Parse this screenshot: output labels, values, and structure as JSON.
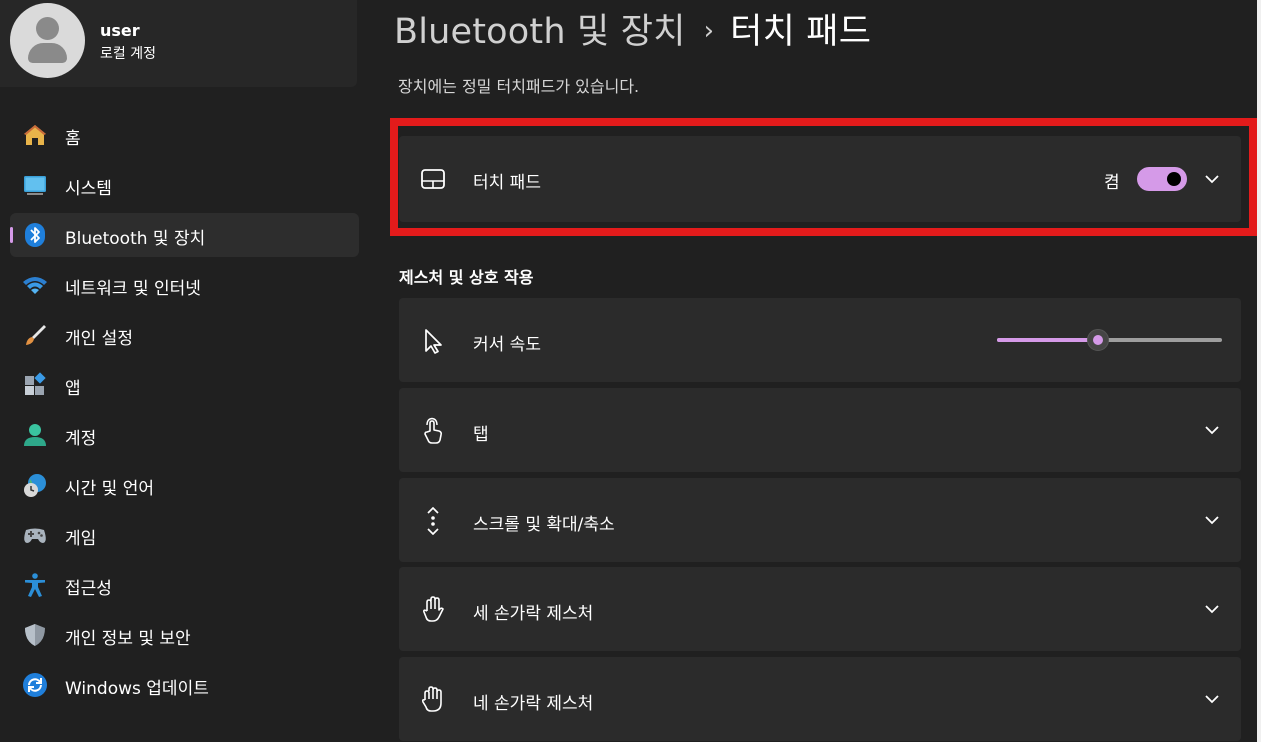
{
  "profile": {
    "name": "user",
    "account_type": "로컬 계정"
  },
  "sidebar": {
    "items": [
      {
        "label": "홈",
        "icon": "home-icon"
      },
      {
        "label": "시스템",
        "icon": "monitor-icon"
      },
      {
        "label": "Bluetooth 및 장치",
        "icon": "bluetooth-icon",
        "active": true
      },
      {
        "label": "네트워크 및 인터넷",
        "icon": "wifi-icon"
      },
      {
        "label": "개인 설정",
        "icon": "paintbrush-icon"
      },
      {
        "label": "앱",
        "icon": "apps-icon"
      },
      {
        "label": "계정",
        "icon": "person-icon"
      },
      {
        "label": "시간 및 언어",
        "icon": "globe-clock-icon"
      },
      {
        "label": "게임",
        "icon": "gamepad-icon"
      },
      {
        "label": "접근성",
        "icon": "accessibility-icon"
      },
      {
        "label": "개인 정보 및 보안",
        "icon": "shield-icon"
      },
      {
        "label": "Windows 업데이트",
        "icon": "update-icon"
      }
    ]
  },
  "header": {
    "breadcrumb_parent": "Bluetooth 및 장치",
    "separator": "›",
    "title": "터치 패드"
  },
  "description": "장치에는 정밀 터치패드가 있습니다.",
  "touchpad": {
    "label": "터치 패드",
    "state_label": "켬",
    "enabled": true
  },
  "gestures_section": {
    "heading": "제스처 및 상호 작용",
    "cursor_speed": {
      "label": "커서 속도",
      "value_fraction": 0.45
    },
    "items": [
      {
        "label": "탭",
        "icon": "tap-icon"
      },
      {
        "label": "스크롤 및 확대/축소",
        "icon": "scroll-icon"
      },
      {
        "label": "세 손가락 제스처",
        "icon": "three-finger-hand-icon"
      },
      {
        "label": "네 손가락 제스처",
        "icon": "four-finger-hand-icon"
      }
    ]
  },
  "colors": {
    "accent": "#d59ae8",
    "highlight_border": "#e31b1b",
    "card_bg": "#2b2b2b",
    "window_bg": "#202020"
  }
}
